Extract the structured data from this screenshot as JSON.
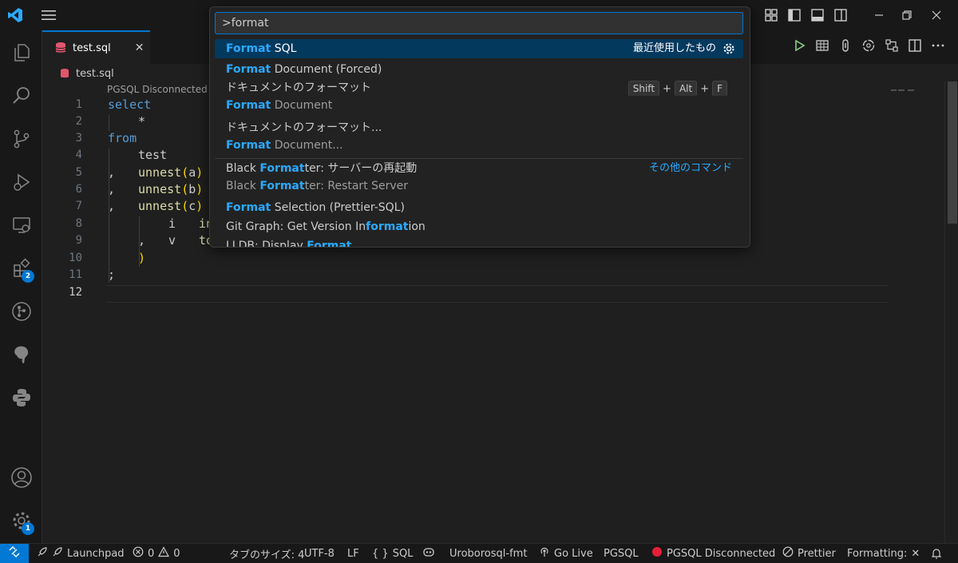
{
  "tab": {
    "label": "test.sql",
    "close": "✕"
  },
  "breadcrumb": {
    "file": "test.sql"
  },
  "codelens": "PGSQL Disconnected",
  "line_numbers": [
    "1",
    "2",
    "3",
    "4",
    "5",
    "6",
    "7",
    "8",
    "9",
    "10",
    "11",
    "12"
  ],
  "code": {
    "l1": "select",
    "l2": "*",
    "l3": "from",
    "l4": "test",
    "l5a": ",",
    "l5b": "unnest",
    "l5c": "(",
    "l5d": "a",
    "l5e": ")",
    "l6a": ",",
    "l6b": "unnest",
    "l6c": "(",
    "l6d": "b",
    "l6e": ")",
    "l7a": ",",
    "l7b": "unnest",
    "l7c": "(",
    "l7d": "c",
    "l7e": ")",
    "l8a": "i",
    "l8b": "in",
    "l9a": ",",
    "l9b": "v",
    "l9c": "to",
    "l10": ")",
    "l11": ";"
  },
  "palette": {
    "query": ">format",
    "items": [
      {
        "hl": "Format",
        "rest": " SQL",
        "right": "最近使用したもの"
      },
      {
        "hl": "Format",
        "rest": " Document (Forced)"
      },
      {
        "main": "ドキュメントのフォーマット",
        "sub_hl": "Format",
        "sub_rest": " Document",
        "keys": [
          "Shift",
          "Alt",
          "F"
        ],
        "plus": "+"
      },
      {
        "main": "ドキュメントのフォーマット...",
        "sub_hl": "Format",
        "sub_rest": " Document..."
      },
      {
        "pre": "Black ",
        "hl": "Format",
        "rest": "ter: サーバーの再起動",
        "sub_pre": "Black ",
        "sub_hl": "Format",
        "sub_rest": "ter: Restart Server",
        "right": "その他のコマンド"
      },
      {
        "hl": "Format",
        "rest": " Selection (Prettier-SQL)"
      },
      {
        "pre": "Git Graph: Get Version In",
        "hl": "format",
        "rest": "ion"
      },
      {
        "pre": "LLDB: Display ",
        "hl": "Format"
      }
    ]
  },
  "activity_badges": {
    "extensions": "2",
    "settings": "1"
  },
  "statusbar": {
    "launchpad": "Launchpad",
    "errors": "0",
    "warnings": "0",
    "tab_size": "タブのサイズ: 4",
    "encoding": "UTF-8",
    "eol": "LF",
    "braces": "{ }",
    "language": "SQL",
    "formatter": "Uroborosql-fmt",
    "golive": "Go Live",
    "pgsql": "PGSQL",
    "pgsql_status": "PGSQL Disconnected",
    "prettier": "Prettier",
    "formatting": "Formatting:",
    "formatting_x": "✕"
  },
  "colors": {
    "accent": "#0078d4",
    "highlight": "#2aaaff",
    "selected": "#04395e",
    "keyword": "#569cd6",
    "function": "#dcdcaa",
    "bracket": "#ffd700",
    "sql_icon": "#e2566d"
  }
}
